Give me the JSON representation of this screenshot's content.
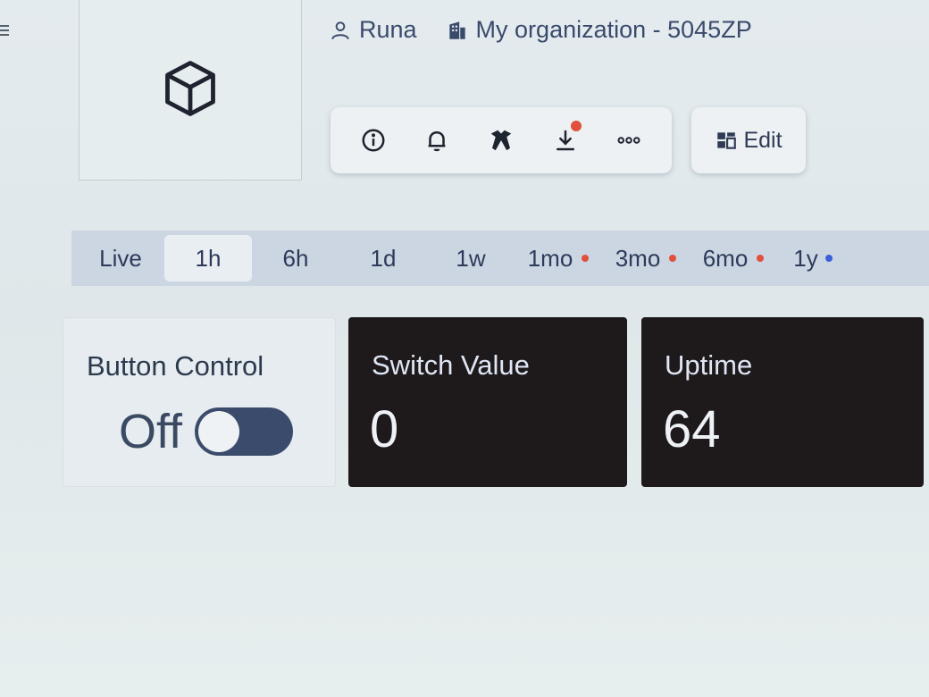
{
  "header": {
    "user_name": "Runa",
    "organization": "My organization - 5045ZP"
  },
  "toolbar": {
    "buttons": [
      {
        "icon": "info-icon"
      },
      {
        "icon": "bell-icon"
      },
      {
        "icon": "tools-icon"
      },
      {
        "icon": "download-icon",
        "has_notification": true
      },
      {
        "icon": "more-icon"
      }
    ],
    "edit_label": "Edit"
  },
  "time_range": {
    "selected": "1h",
    "options": [
      {
        "label": "Live"
      },
      {
        "label": "1h"
      },
      {
        "label": "6h"
      },
      {
        "label": "1d"
      },
      {
        "label": "1w"
      },
      {
        "label": "1mo",
        "dot_color": "#e0503a"
      },
      {
        "label": "3mo",
        "dot_color": "#e0503a"
      },
      {
        "label": "6mo",
        "dot_color": "#e0503a"
      },
      {
        "label": "1y",
        "dot_color": "#3a5fd9"
      }
    ]
  },
  "widgets": {
    "button_control": {
      "title": "Button Control",
      "state_label": "Off",
      "is_on": false
    },
    "switch_value": {
      "title": "Switch Value",
      "value": "0"
    },
    "uptime": {
      "title": "Uptime",
      "value": "64"
    }
  },
  "colors": {
    "accent": "#3b4b6b",
    "dark_widget": "#1e1a1c",
    "range_bar": "#cbd6e2",
    "alert_dot": "#e0503a",
    "info_dot": "#3a5fd9"
  }
}
